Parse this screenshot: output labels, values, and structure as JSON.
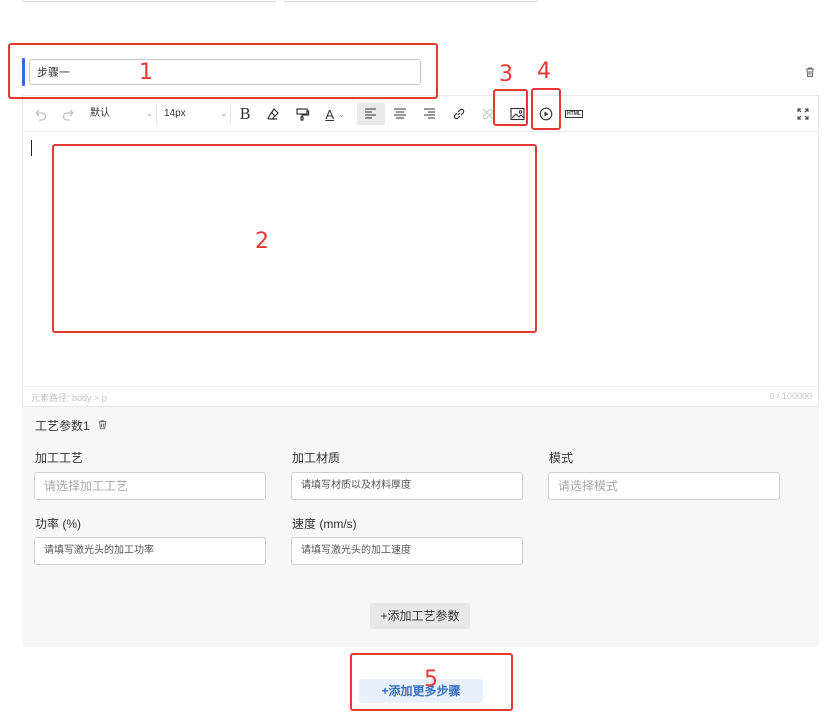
{
  "step": {
    "title_value": "步骤一"
  },
  "toolbar": {
    "font_family": "默认",
    "font_size": "14px",
    "bold_label": "B",
    "font_color_label": "A",
    "html_label": "HTML"
  },
  "editor": {
    "element_path": "元素路径: body > p",
    "char_count": "0 / 100000"
  },
  "params": {
    "section_title": "工艺参数1",
    "process_label": "加工工艺",
    "process_placeholder": "请选择加工工艺",
    "material_label": "加工材质",
    "material_placeholder": "请填写材质以及材料厚度",
    "mode_label": "模式",
    "mode_placeholder": "请选择模式",
    "power_label": "功率 (%)",
    "power_placeholder": "请填写激光头的加工功率",
    "speed_label": "速度 (mm/s)",
    "speed_placeholder": "请填写激光头的加工速度",
    "add_param_label": "+添加工艺参数"
  },
  "actions": {
    "add_step_label": "+添加更多步骤"
  },
  "annotations": [
    "1",
    "2",
    "3",
    "4",
    "5"
  ],
  "colors": {
    "accent": "#2e6fd6",
    "annotation": "#e53935",
    "add_step_text": "#3a72c4",
    "add_step_bg": "#e7f0fb"
  },
  "icons": [
    "undo-icon",
    "redo-icon",
    "eraser-icon",
    "format-painter-icon",
    "align-left-icon",
    "align-center-icon",
    "align-right-icon",
    "link-icon",
    "unlink-icon",
    "image-icon",
    "video-icon",
    "html-icon",
    "fullscreen-icon",
    "trash-icon"
  ]
}
